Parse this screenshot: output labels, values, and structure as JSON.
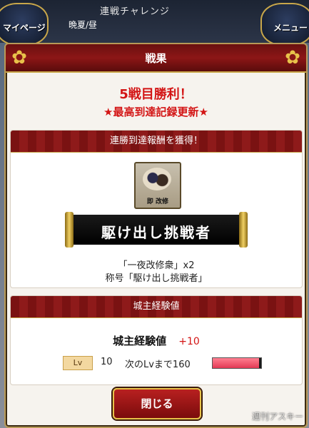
{
  "top": {
    "title": "連戦チャレンジ",
    "subtitle": "晩夏/昼",
    "left_button": "マイページ",
    "right_button": "メニュー"
  },
  "dialog": {
    "header": "戦果",
    "win_text": "5戦目勝利！",
    "record_text": "★最高到達記録更新★",
    "reward_section": {
      "header": "連勝到達報酬を獲得！",
      "icon_label": "即 改修",
      "title_name": "駆け出し挑戦者",
      "line1": "「一夜改修衆」x2",
      "line2": "称号「駆け出し挑戦者」"
    },
    "exp_section": {
      "header": "城主経験値",
      "label": "城主経験値",
      "gain": "+10",
      "lv_badge": "Lv",
      "level": "10",
      "next_text": "次のLvまで160",
      "progress": 0.95
    },
    "close_label": "閉じる"
  },
  "watermark": "週刊アスキー",
  "colors": {
    "accent_red": "#d31414",
    "gold": "#e8c24a",
    "header_red": "#8c1616"
  }
}
